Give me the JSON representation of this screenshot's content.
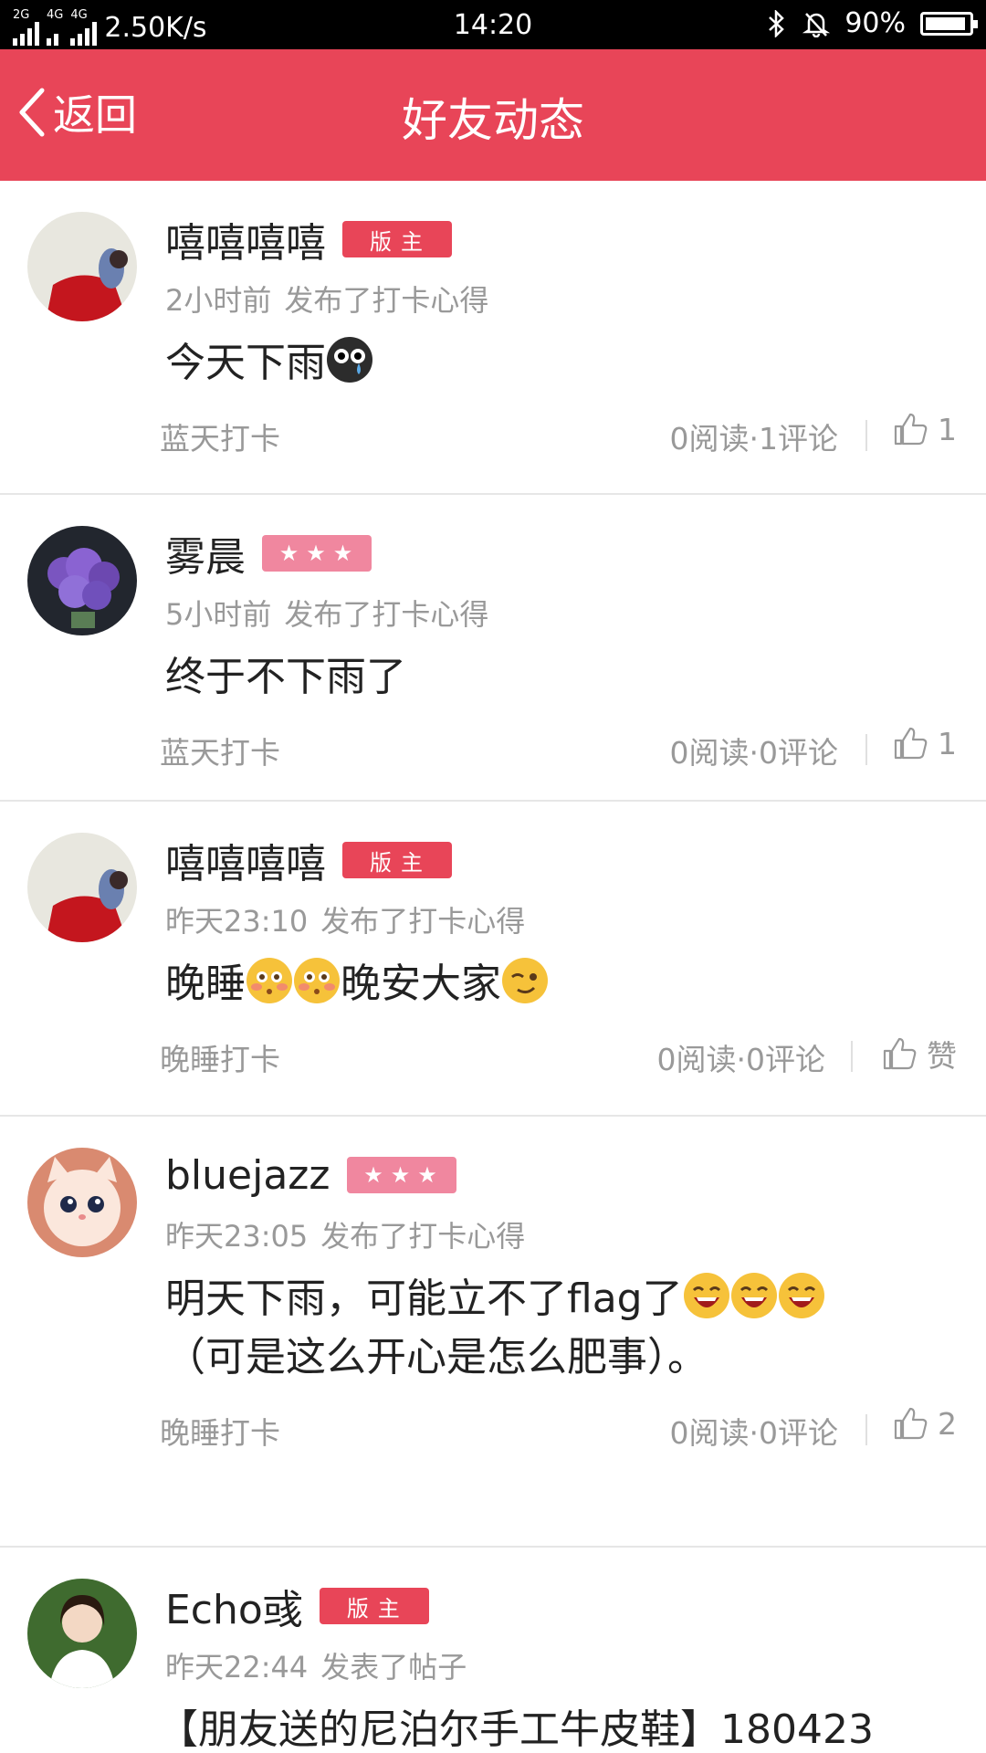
{
  "status_bar": {
    "net_2g": "2G",
    "net_4g": "4G",
    "net_4g2": "4G",
    "speed": "2.50K/s",
    "time": "14:20",
    "battery": "90%",
    "battery_level": 0.9
  },
  "header": {
    "back_label": "返回",
    "title": "好友动态"
  },
  "posts": [
    {
      "name": "嘻嘻嘻嘻",
      "badge": "版主",
      "time": "2小时前",
      "action": "发布了打卡心得",
      "text": "今天下雨",
      "tag": "蓝天打卡",
      "stats": "0阅读·1评论",
      "likes": "1"
    },
    {
      "name": "雾晨",
      "badge": "★★★",
      "time": "5小时前",
      "action": "发布了打卡心得",
      "text": "终于不下雨了",
      "tag": "蓝天打卡",
      "stats": "0阅读·0评论",
      "likes": "1"
    },
    {
      "name": "嘻嘻嘻嘻",
      "badge": "版主",
      "time": "昨天23:10",
      "action": "发布了打卡心得",
      "text_a": "晚睡",
      "text_b": "晚安大家",
      "tag": "晚睡打卡",
      "stats": "0阅读·0评论",
      "likes": "赞"
    },
    {
      "name": "bluejazz",
      "badge": "★★★",
      "time": "昨天23:05",
      "action": "发布了打卡心得",
      "text_a": "明天下雨，可能立不了flag了",
      "text_b": "（可是这么开心是怎么肥事）。",
      "tag": "晚睡打卡",
      "stats": "0阅读·0评论",
      "likes": "2"
    },
    {
      "name": "Echo彧",
      "badge": "版主",
      "time": "昨天22:44",
      "action": "发表了帖子",
      "text": "【朋友送的尼泊尔手工牛皮鞋】180423"
    }
  ],
  "colors": {
    "accent": "#e84558",
    "badge_stars": "#f0879f",
    "muted_text": "#999999"
  },
  "icons": [
    "chevron-left-icon",
    "thumbs-up-icon",
    "bluetooth-icon",
    "bell-muted-icon",
    "battery-icon",
    "crying-emoji",
    "blushing-emoji",
    "winking-emoji",
    "laughing-emoji"
  ]
}
